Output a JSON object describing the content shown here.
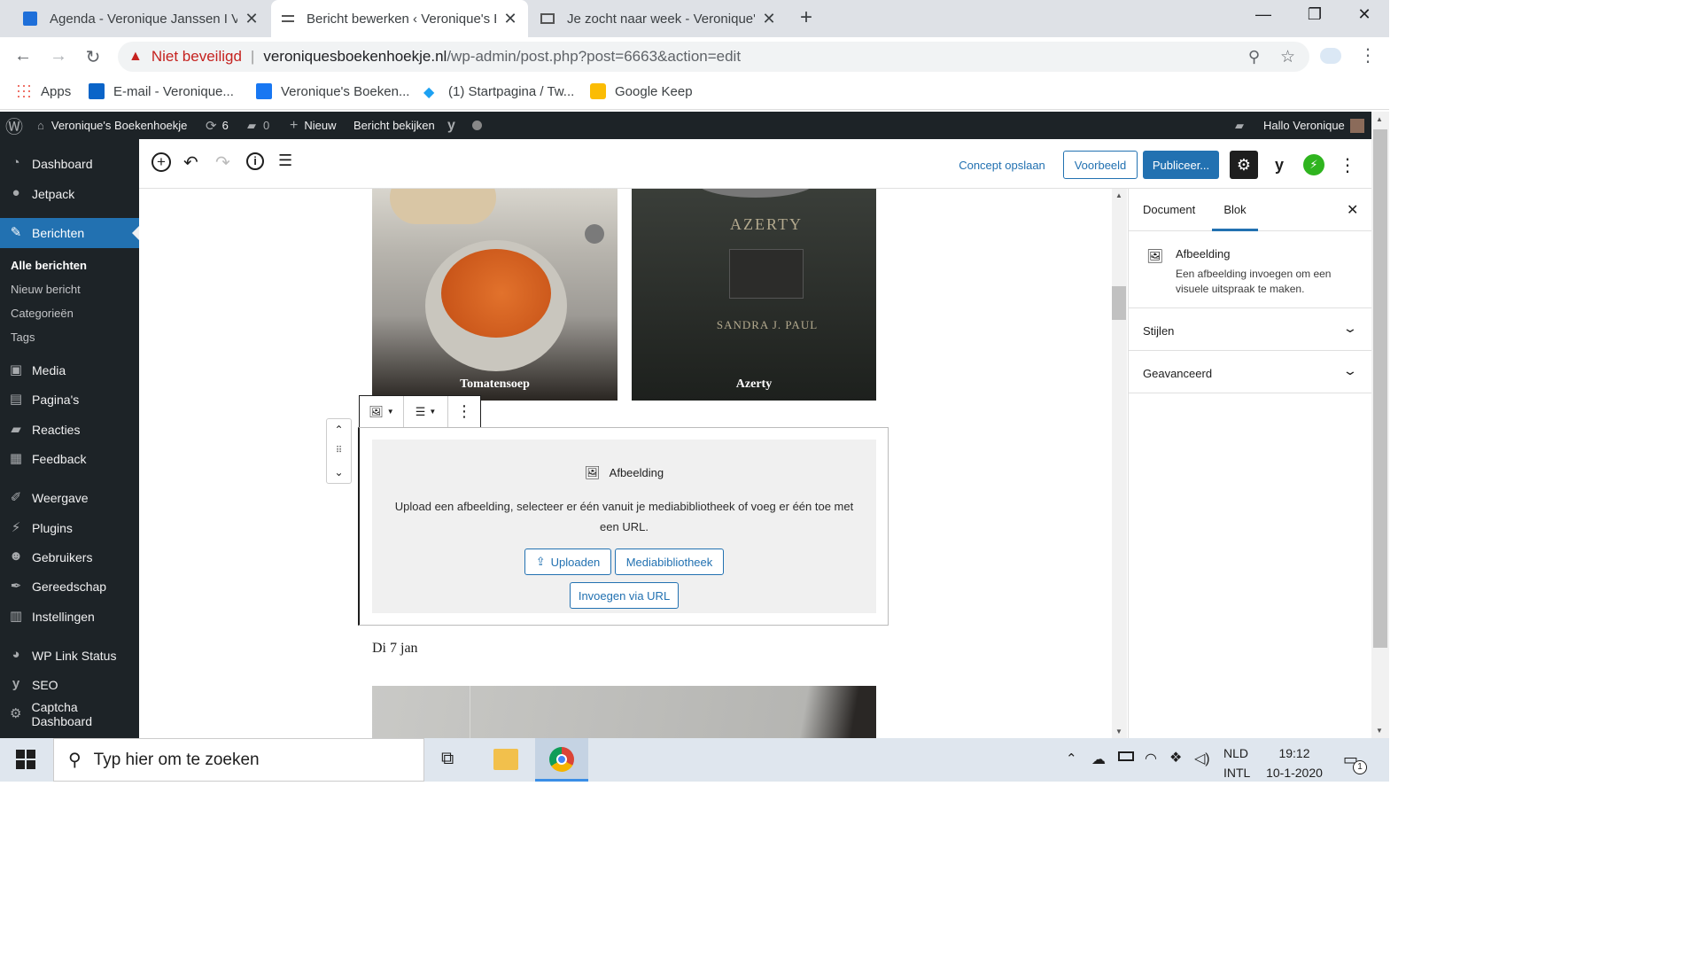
{
  "browser": {
    "tabs": [
      {
        "title": "Agenda - Veronique Janssen I Ve"
      },
      {
        "title": "Bericht bewerken ‹ Veronique's B"
      },
      {
        "title": "Je zocht naar week - Veronique's"
      }
    ],
    "security_label": "Niet beveiligd",
    "url_host": "veroniquesboekenhoekje.nl",
    "url_path": "/wp-admin/post.php?post=6663&action=edit",
    "bookmarks": [
      "Apps",
      "E-mail - Veronique...",
      "Veronique's Boeken...",
      "(1) Startpagina / Tw...",
      "Google Keep"
    ]
  },
  "adminbar": {
    "site_name": "Veronique's Boekenhoekje",
    "updates": "6",
    "comments": "0",
    "new_label": "Nieuw",
    "view_post": "Bericht bekijken",
    "greeting": "Hallo Veronique"
  },
  "sidebar": {
    "items": [
      {
        "label": "Dashboard",
        "icon": "dashboard-icon"
      },
      {
        "label": "Jetpack",
        "icon": "jetpack-icon"
      },
      {
        "label": "Berichten",
        "icon": "pin-icon"
      },
      {
        "label": "Media",
        "icon": "media-icon"
      },
      {
        "label": "Pagina's",
        "icon": "pages-icon"
      },
      {
        "label": "Reacties",
        "icon": "comments-icon"
      },
      {
        "label": "Feedback",
        "icon": "feedback-icon"
      },
      {
        "label": "Weergave",
        "icon": "appearance-icon"
      },
      {
        "label": "Plugins",
        "icon": "plugins-icon"
      },
      {
        "label": "Gebruikers",
        "icon": "users-icon"
      },
      {
        "label": "Gereedschap",
        "icon": "tools-icon"
      },
      {
        "label": "Instellingen",
        "icon": "settings-icon"
      },
      {
        "label": "WP Link Status",
        "icon": "link-status-icon"
      },
      {
        "label": "SEO",
        "icon": "yoast-icon"
      },
      {
        "label": "Captcha Dashboard",
        "icon": "captcha-icon"
      }
    ],
    "subitems": [
      "Alle berichten",
      "Nieuw bericht",
      "Categorieën",
      "Tags"
    ]
  },
  "editor": {
    "save_draft": "Concept opslaan",
    "preview": "Voorbeeld",
    "publish": "Publiceer...",
    "gallery_captions": [
      "Tomatensoep",
      "Azerty"
    ],
    "placeholder_title": "Afbeelding",
    "placeholder_text": "Upload een afbeelding, selecteer er één vanuit je mediabibliotheek of voeg er één toe met een URL.",
    "btn_upload": "Uploaden",
    "btn_media": "Mediabibliotheek",
    "btn_url": "Invoegen via URL",
    "paragraph": "Di 7 jan",
    "book_title": "AZERTY",
    "book_author": "SANDRA J. PAUL"
  },
  "panel": {
    "tab_document": "Document",
    "tab_block": "Blok",
    "block_title": "Afbeelding",
    "block_desc": "Een afbeelding invoegen om een visuele uitspraak te maken.",
    "sections": [
      "Stijlen",
      "Geavanceerd"
    ]
  },
  "taskbar": {
    "search_placeholder": "Typ hier om te zoeken",
    "lang1": "NLD",
    "lang2": "INTL",
    "time": "19:12",
    "date": "10-1-2020",
    "notifications": "1"
  },
  "colors": {
    "wp_blue": "#2271b1",
    "admin_dark": "#1d2327",
    "security_red": "#c5221f"
  }
}
